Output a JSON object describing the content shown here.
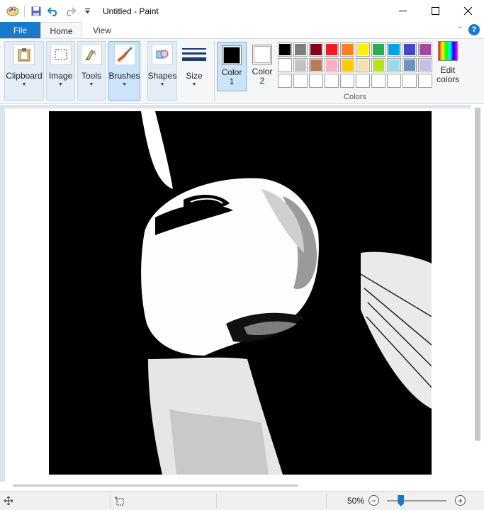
{
  "window": {
    "title": "Untitled - Paint",
    "controls": [
      "minimize",
      "maximize",
      "close"
    ]
  },
  "quick_access": [
    {
      "name": "paint-app-icon"
    },
    {
      "name": "save-icon"
    },
    {
      "name": "undo-icon"
    },
    {
      "name": "redo-icon"
    },
    {
      "name": "customize-dropdown-icon"
    }
  ],
  "tabs": {
    "file": "File",
    "home": "Home",
    "view": "View",
    "active": "Home"
  },
  "ribbon": {
    "clipboard": "Clipboard",
    "image": "Image",
    "tools": "Tools",
    "brushes": "Brushes",
    "shapes": "Shapes",
    "size": "Size",
    "color1_line1": "Color",
    "color1_line2": "1",
    "color2_line1": "Color",
    "color2_line2": "2",
    "colors_group": "Colors",
    "edit_colors_line1": "Edit",
    "edit_colors_line2": "colors",
    "selected_tool": "Brushes"
  },
  "colors": {
    "color1": "#000000",
    "color2": "#ffffff",
    "accent": "#1979ca",
    "palette": [
      "#000000",
      "#7f7f7f",
      "#880015",
      "#ed1c24",
      "#ff7f27",
      "#fff200",
      "#22b14c",
      "#00a2e8",
      "#3f48cc",
      "#a349a4",
      "#ffffff",
      "#c3c3c3",
      "#b97a57",
      "#ffaec9",
      "#ffc90e",
      "#efe4b0",
      "#b5e61d",
      "#99d9ea",
      "#7092be",
      "#c8bfe7",
      "",
      "",
      "",
      "",
      "",
      "",
      "",
      "",
      "",
      ""
    ]
  },
  "status": {
    "zoom": "50%",
    "zoom_level": 0.23
  }
}
